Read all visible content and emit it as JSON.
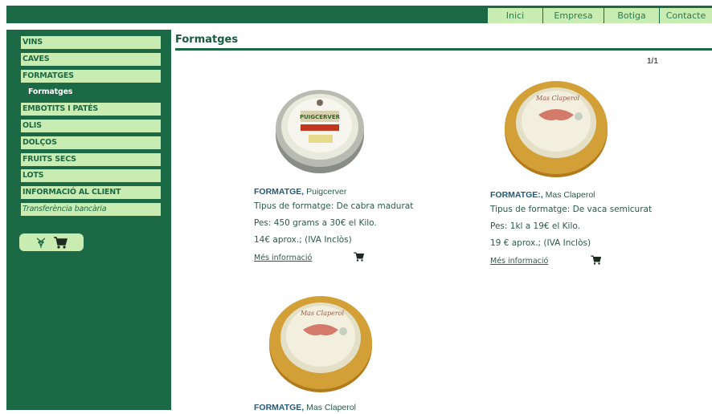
{
  "top_nav": [
    "Inici",
    "Empresa",
    "Botiga",
    "Contacte"
  ],
  "sidebar": {
    "items": [
      {
        "label": "VINS",
        "type": "main"
      },
      {
        "label": "CAVES",
        "type": "main"
      },
      {
        "label": "FORMATGES",
        "type": "main"
      },
      {
        "label": "Formatges",
        "type": "sub"
      },
      {
        "label": "EMBOTITS I PATÉS",
        "type": "main"
      },
      {
        "label": "OLIS",
        "type": "main"
      },
      {
        "label": "DOLÇOS",
        "type": "main"
      },
      {
        "label": "FRUITS SECS",
        "type": "main"
      },
      {
        "label": "LOTS",
        "type": "main"
      },
      {
        "label": "INFORMACIÓ AL CLIENT",
        "type": "main"
      },
      {
        "label": "Transferència bancària",
        "type": "italic"
      }
    ]
  },
  "page": {
    "title": "Formatges",
    "pagination": "1/1"
  },
  "products": [
    {
      "title_bold": "FORMATGE,",
      "title_rest": " Puigcerver",
      "type_line": "Tipus de formatge: De cabra madurat",
      "weight_line": "Pes: 450 grams a 30€ el Kilo.",
      "price_line": "14€ aprox.; (IVA Inclòs)",
      "link": "Més informació",
      "label_text": "PUIGCERVER"
    },
    {
      "title_bold": "FORMATGE:,",
      "title_rest": " Mas Claperol",
      "type_line": "Tipus de formatge: De vaca semicurat",
      "weight_line": "Pes: 1kl a 19€ el Kilo.",
      "price_line": "19 € aprox.; (IVA Inclòs)",
      "link": "Més informació",
      "label_text": "Mas Claperol"
    },
    {
      "title_bold": "FORMATGE,",
      "title_rest": " Mas Claperol",
      "label_text": "Mas Claperol"
    }
  ],
  "colors": {
    "brand_green": "#1c6a45",
    "menu_bg": "#c9ecb2",
    "cheese_rind": "#c9912a"
  }
}
